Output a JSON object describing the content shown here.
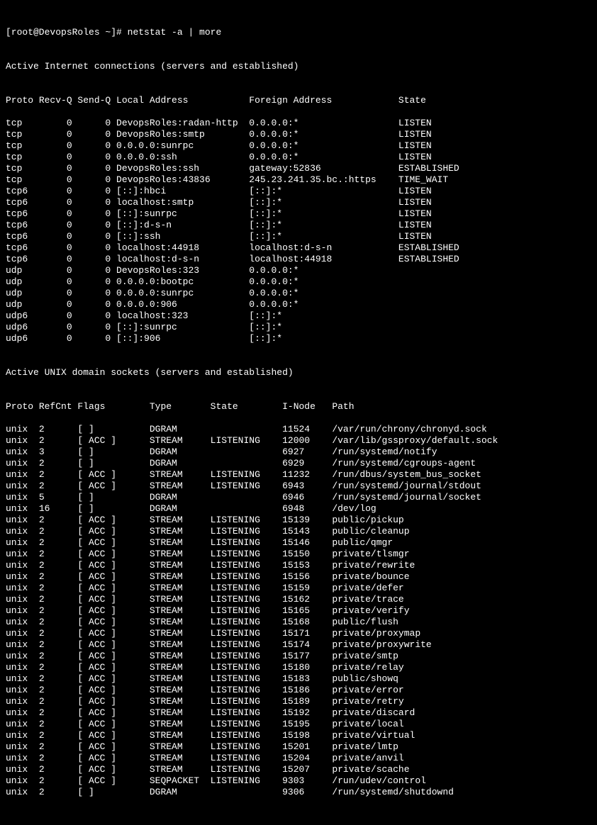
{
  "prompt_prefix": "[root@DevopsRoles ~]# ",
  "command": "netstat -a | more",
  "inet_title": "Active Internet connections (servers and established)",
  "inet_hdr": {
    "proto": "Proto",
    "recvq": "Recv-Q",
    "sendq": "Send-Q",
    "local": "Local Address",
    "foreign": "Foreign Address",
    "state": "State"
  },
  "inet_rows": [
    {
      "proto": "tcp",
      "recvq": "0",
      "sendq": "0",
      "local": "DevopsRoles:radan-http",
      "foreign": "0.0.0.0:*",
      "state": "LISTEN"
    },
    {
      "proto": "tcp",
      "recvq": "0",
      "sendq": "0",
      "local": "DevopsRoles:smtp",
      "foreign": "0.0.0.0:*",
      "state": "LISTEN"
    },
    {
      "proto": "tcp",
      "recvq": "0",
      "sendq": "0",
      "local": "0.0.0.0:sunrpc",
      "foreign": "0.0.0.0:*",
      "state": "LISTEN"
    },
    {
      "proto": "tcp",
      "recvq": "0",
      "sendq": "0",
      "local": "0.0.0.0:ssh",
      "foreign": "0.0.0.0:*",
      "state": "LISTEN"
    },
    {
      "proto": "tcp",
      "recvq": "0",
      "sendq": "0",
      "local": "DevopsRoles:ssh",
      "foreign": "gateway:52836",
      "state": "ESTABLISHED"
    },
    {
      "proto": "tcp",
      "recvq": "0",
      "sendq": "0",
      "local": "DevopsRoles:43836",
      "foreign": "245.23.241.35.bc.:https",
      "state": "TIME_WAIT"
    },
    {
      "proto": "tcp6",
      "recvq": "0",
      "sendq": "0",
      "local": "[::]:hbci",
      "foreign": "[::]:*",
      "state": "LISTEN"
    },
    {
      "proto": "tcp6",
      "recvq": "0",
      "sendq": "0",
      "local": "localhost:smtp",
      "foreign": "[::]:*",
      "state": "LISTEN"
    },
    {
      "proto": "tcp6",
      "recvq": "0",
      "sendq": "0",
      "local": "[::]:sunrpc",
      "foreign": "[::]:*",
      "state": "LISTEN"
    },
    {
      "proto": "tcp6",
      "recvq": "0",
      "sendq": "0",
      "local": "[::]:d-s-n",
      "foreign": "[::]:*",
      "state": "LISTEN"
    },
    {
      "proto": "tcp6",
      "recvq": "0",
      "sendq": "0",
      "local": "[::]:ssh",
      "foreign": "[::]:*",
      "state": "LISTEN"
    },
    {
      "proto": "tcp6",
      "recvq": "0",
      "sendq": "0",
      "local": "localhost:44918",
      "foreign": "localhost:d-s-n",
      "state": "ESTABLISHED"
    },
    {
      "proto": "tcp6",
      "recvq": "0",
      "sendq": "0",
      "local": "localhost:d-s-n",
      "foreign": "localhost:44918",
      "state": "ESTABLISHED"
    },
    {
      "proto": "udp",
      "recvq": "0",
      "sendq": "0",
      "local": "DevopsRoles:323",
      "foreign": "0.0.0.0:*",
      "state": ""
    },
    {
      "proto": "udp",
      "recvq": "0",
      "sendq": "0",
      "local": "0.0.0.0:bootpc",
      "foreign": "0.0.0.0:*",
      "state": ""
    },
    {
      "proto": "udp",
      "recvq": "0",
      "sendq": "0",
      "local": "0.0.0.0:sunrpc",
      "foreign": "0.0.0.0:*",
      "state": ""
    },
    {
      "proto": "udp",
      "recvq": "0",
      "sendq": "0",
      "local": "0.0.0.0:906",
      "foreign": "0.0.0.0:*",
      "state": ""
    },
    {
      "proto": "udp6",
      "recvq": "0",
      "sendq": "0",
      "local": "localhost:323",
      "foreign": "[::]:*",
      "state": ""
    },
    {
      "proto": "udp6",
      "recvq": "0",
      "sendq": "0",
      "local": "[::]:sunrpc",
      "foreign": "[::]:*",
      "state": ""
    },
    {
      "proto": "udp6",
      "recvq": "0",
      "sendq": "0",
      "local": "[::]:906",
      "foreign": "[::]:*",
      "state": ""
    }
  ],
  "unix_title": "Active UNIX domain sockets (servers and established)",
  "unix_hdr": {
    "proto": "Proto",
    "refcnt": "RefCnt",
    "flags": "Flags",
    "type": "Type",
    "state": "State",
    "inode": "I-Node",
    "path": "Path"
  },
  "unix_rows": [
    {
      "proto": "unix",
      "refcnt": "2",
      "flags": "[ ]",
      "type": "DGRAM",
      "state": "",
      "inode": "11524",
      "path": "/var/run/chrony/chronyd.sock"
    },
    {
      "proto": "unix",
      "refcnt": "2",
      "flags": "[ ACC ]",
      "type": "STREAM",
      "state": "LISTENING",
      "inode": "12000",
      "path": "/var/lib/gssproxy/default.sock"
    },
    {
      "proto": "unix",
      "refcnt": "3",
      "flags": "[ ]",
      "type": "DGRAM",
      "state": "",
      "inode": "6927",
      "path": "/run/systemd/notify"
    },
    {
      "proto": "unix",
      "refcnt": "2",
      "flags": "[ ]",
      "type": "DGRAM",
      "state": "",
      "inode": "6929",
      "path": "/run/systemd/cgroups-agent"
    },
    {
      "proto": "unix",
      "refcnt": "2",
      "flags": "[ ACC ]",
      "type": "STREAM",
      "state": "LISTENING",
      "inode": "11232",
      "path": "/run/dbus/system_bus_socket"
    },
    {
      "proto": "unix",
      "refcnt": "2",
      "flags": "[ ACC ]",
      "type": "STREAM",
      "state": "LISTENING",
      "inode": "6943",
      "path": "/run/systemd/journal/stdout"
    },
    {
      "proto": "unix",
      "refcnt": "5",
      "flags": "[ ]",
      "type": "DGRAM",
      "state": "",
      "inode": "6946",
      "path": "/run/systemd/journal/socket"
    },
    {
      "proto": "unix",
      "refcnt": "16",
      "flags": "[ ]",
      "type": "DGRAM",
      "state": "",
      "inode": "6948",
      "path": "/dev/log"
    },
    {
      "proto": "unix",
      "refcnt": "2",
      "flags": "[ ACC ]",
      "type": "STREAM",
      "state": "LISTENING",
      "inode": "15139",
      "path": "public/pickup"
    },
    {
      "proto": "unix",
      "refcnt": "2",
      "flags": "[ ACC ]",
      "type": "STREAM",
      "state": "LISTENING",
      "inode": "15143",
      "path": "public/cleanup"
    },
    {
      "proto": "unix",
      "refcnt": "2",
      "flags": "[ ACC ]",
      "type": "STREAM",
      "state": "LISTENING",
      "inode": "15146",
      "path": "public/qmgr"
    },
    {
      "proto": "unix",
      "refcnt": "2",
      "flags": "[ ACC ]",
      "type": "STREAM",
      "state": "LISTENING",
      "inode": "15150",
      "path": "private/tlsmgr"
    },
    {
      "proto": "unix",
      "refcnt": "2",
      "flags": "[ ACC ]",
      "type": "STREAM",
      "state": "LISTENING",
      "inode": "15153",
      "path": "private/rewrite"
    },
    {
      "proto": "unix",
      "refcnt": "2",
      "flags": "[ ACC ]",
      "type": "STREAM",
      "state": "LISTENING",
      "inode": "15156",
      "path": "private/bounce"
    },
    {
      "proto": "unix",
      "refcnt": "2",
      "flags": "[ ACC ]",
      "type": "STREAM",
      "state": "LISTENING",
      "inode": "15159",
      "path": "private/defer"
    },
    {
      "proto": "unix",
      "refcnt": "2",
      "flags": "[ ACC ]",
      "type": "STREAM",
      "state": "LISTENING",
      "inode": "15162",
      "path": "private/trace"
    },
    {
      "proto": "unix",
      "refcnt": "2",
      "flags": "[ ACC ]",
      "type": "STREAM",
      "state": "LISTENING",
      "inode": "15165",
      "path": "private/verify"
    },
    {
      "proto": "unix",
      "refcnt": "2",
      "flags": "[ ACC ]",
      "type": "STREAM",
      "state": "LISTENING",
      "inode": "15168",
      "path": "public/flush"
    },
    {
      "proto": "unix",
      "refcnt": "2",
      "flags": "[ ACC ]",
      "type": "STREAM",
      "state": "LISTENING",
      "inode": "15171",
      "path": "private/proxymap"
    },
    {
      "proto": "unix",
      "refcnt": "2",
      "flags": "[ ACC ]",
      "type": "STREAM",
      "state": "LISTENING",
      "inode": "15174",
      "path": "private/proxywrite"
    },
    {
      "proto": "unix",
      "refcnt": "2",
      "flags": "[ ACC ]",
      "type": "STREAM",
      "state": "LISTENING",
      "inode": "15177",
      "path": "private/smtp"
    },
    {
      "proto": "unix",
      "refcnt": "2",
      "flags": "[ ACC ]",
      "type": "STREAM",
      "state": "LISTENING",
      "inode": "15180",
      "path": "private/relay"
    },
    {
      "proto": "unix",
      "refcnt": "2",
      "flags": "[ ACC ]",
      "type": "STREAM",
      "state": "LISTENING",
      "inode": "15183",
      "path": "public/showq"
    },
    {
      "proto": "unix",
      "refcnt": "2",
      "flags": "[ ACC ]",
      "type": "STREAM",
      "state": "LISTENING",
      "inode": "15186",
      "path": "private/error"
    },
    {
      "proto": "unix",
      "refcnt": "2",
      "flags": "[ ACC ]",
      "type": "STREAM",
      "state": "LISTENING",
      "inode": "15189",
      "path": "private/retry"
    },
    {
      "proto": "unix",
      "refcnt": "2",
      "flags": "[ ACC ]",
      "type": "STREAM",
      "state": "LISTENING",
      "inode": "15192",
      "path": "private/discard"
    },
    {
      "proto": "unix",
      "refcnt": "2",
      "flags": "[ ACC ]",
      "type": "STREAM",
      "state": "LISTENING",
      "inode": "15195",
      "path": "private/local"
    },
    {
      "proto": "unix",
      "refcnt": "2",
      "flags": "[ ACC ]",
      "type": "STREAM",
      "state": "LISTENING",
      "inode": "15198",
      "path": "private/virtual"
    },
    {
      "proto": "unix",
      "refcnt": "2",
      "flags": "[ ACC ]",
      "type": "STREAM",
      "state": "LISTENING",
      "inode": "15201",
      "path": "private/lmtp"
    },
    {
      "proto": "unix",
      "refcnt": "2",
      "flags": "[ ACC ]",
      "type": "STREAM",
      "state": "LISTENING",
      "inode": "15204",
      "path": "private/anvil"
    },
    {
      "proto": "unix",
      "refcnt": "2",
      "flags": "[ ACC ]",
      "type": "STREAM",
      "state": "LISTENING",
      "inode": "15207",
      "path": "private/scache"
    },
    {
      "proto": "unix",
      "refcnt": "2",
      "flags": "[ ACC ]",
      "type": "SEQPACKET",
      "state": "LISTENING",
      "inode": "9303",
      "path": "/run/udev/control"
    },
    {
      "proto": "unix",
      "refcnt": "2",
      "flags": "[ ]",
      "type": "DGRAM",
      "state": "",
      "inode": "9306",
      "path": "/run/systemd/shutdownd"
    }
  ]
}
